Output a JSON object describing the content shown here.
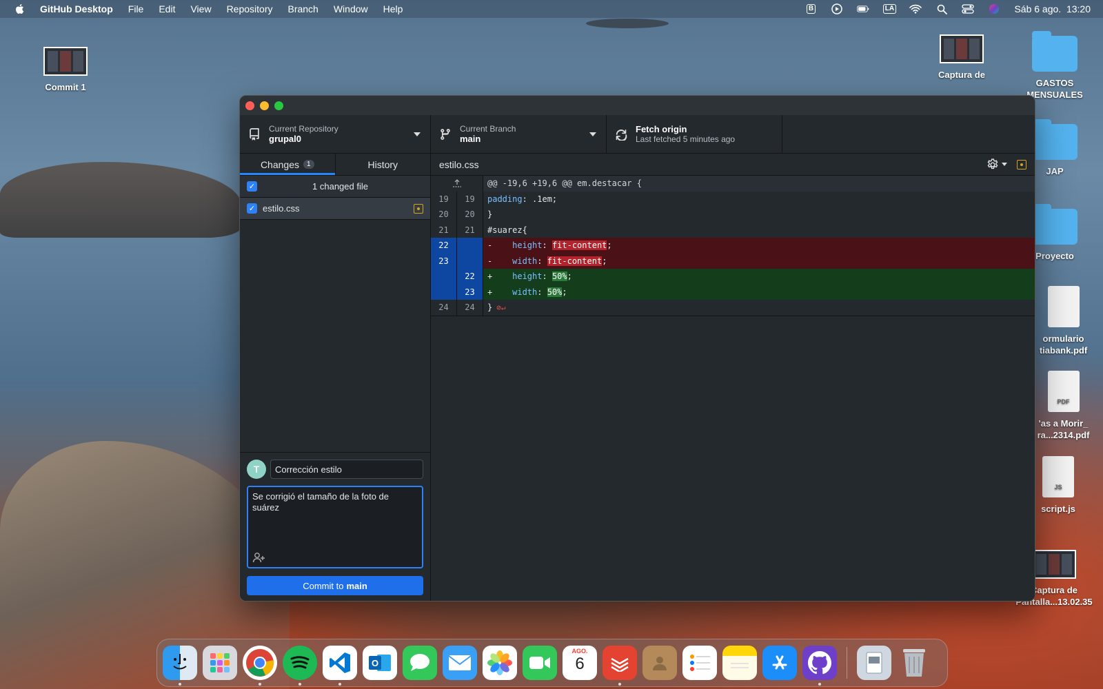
{
  "menubar": {
    "app_name": "GitHub Desktop",
    "menus": [
      "File",
      "Edit",
      "View",
      "Repository",
      "Branch",
      "Window",
      "Help"
    ],
    "keyboard_layout": "LA",
    "clock": "Sáb 6 ago.  13:20"
  },
  "desktop_icons": [
    {
      "label": "Commit 1"
    },
    {
      "label": "Captura de"
    },
    {
      "label": "GASTOS MENSUALES"
    },
    {
      "label": "JAP"
    },
    {
      "label": "Proyecto"
    },
    {
      "label": "ormulario tiabank.pdf"
    },
    {
      "label": "'as a Morir_ ra...2314.pdf"
    },
    {
      "label": "script.js"
    },
    {
      "label": "Captura de Pantalla...13.02.35"
    }
  ],
  "window": {
    "toolbar": {
      "repo_label": "Current Repository",
      "repo_value": "grupal0",
      "branch_label": "Current Branch",
      "branch_value": "main",
      "fetch_label": "Fetch origin",
      "fetch_sub": "Last fetched 5 minutes ago"
    },
    "tabs": {
      "changes": "Changes",
      "changes_count": "1",
      "history": "History"
    },
    "changes": {
      "header": "1 changed file",
      "files": [
        {
          "name": "estilo.css",
          "status": "modified"
        }
      ]
    },
    "commit": {
      "avatar_letter": "T",
      "summary": "Corrección estilo",
      "description": "Se corrigió el tamaño de la foto de suárez",
      "button_prefix": "Commit to",
      "button_branch": "main"
    },
    "diff": {
      "file_name": "estilo.css",
      "hunk_header": "@@ -19,6 +19,6 @@ em.destacar {",
      "lines": [
        {
          "old": "19",
          "new": "19",
          "type": "ctx",
          "text": "    padding: .1em;"
        },
        {
          "old": "20",
          "new": "20",
          "type": "ctx",
          "text": "}"
        },
        {
          "old": "21",
          "new": "21",
          "type": "ctx",
          "text": "#suarez{"
        },
        {
          "old": "22",
          "new": "",
          "type": "del",
          "text": "-    height: fit-content;"
        },
        {
          "old": "23",
          "new": "",
          "type": "del",
          "text": "-    width: fit-content;"
        },
        {
          "old": "",
          "new": "22",
          "type": "add",
          "text": "+    height: 50%;"
        },
        {
          "old": "",
          "new": "23",
          "type": "add",
          "text": "+    width: 50%;"
        },
        {
          "old": "24",
          "new": "24",
          "type": "ctx",
          "text": "}"
        }
      ]
    }
  },
  "dock": {
    "calendar_month": "AGO.",
    "calendar_day": "6"
  },
  "colors": {
    "accent": "#1f6feb",
    "deletion": "#4a1216",
    "addition": "#143d1c",
    "modified": "#d6a520"
  }
}
